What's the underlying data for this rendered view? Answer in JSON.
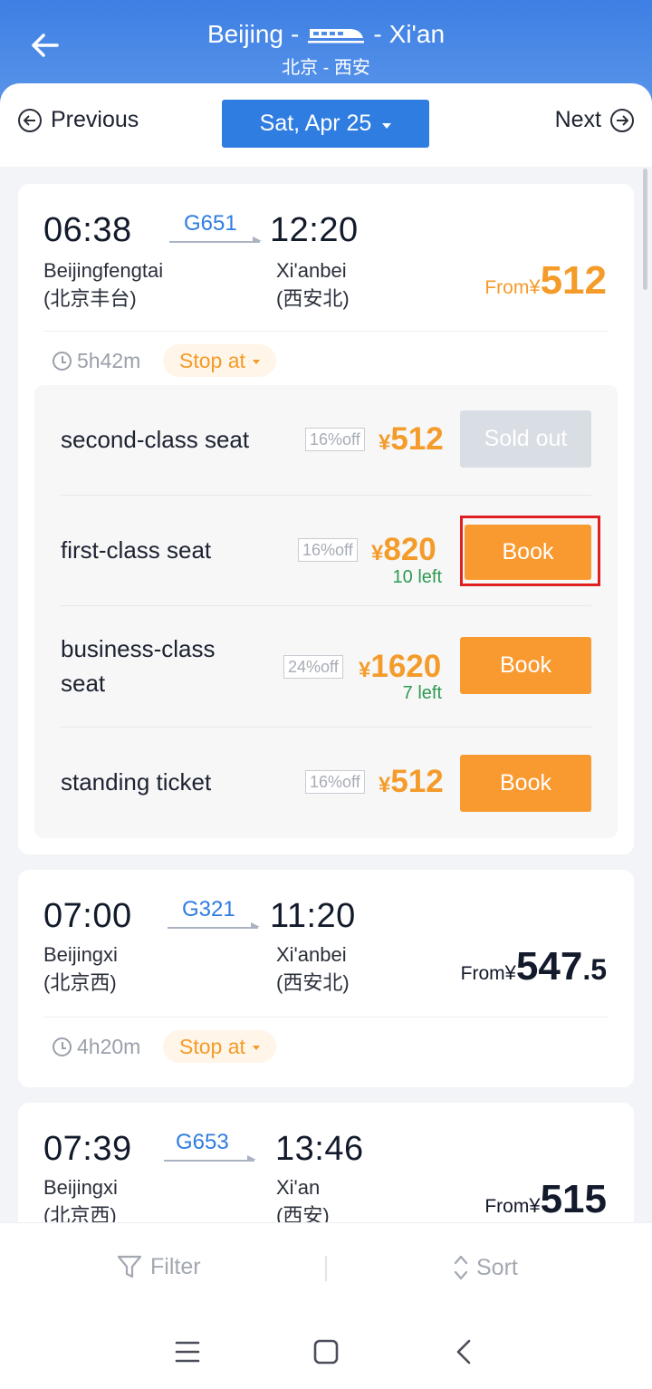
{
  "header": {
    "from_city": "Beijing",
    "to_city": "Xi'an",
    "route_cn": "北京 - 西安",
    "back_icon": "arrow-left-icon"
  },
  "datebar": {
    "prev_label": "Previous",
    "next_label": "Next",
    "date_label": "Sat, Apr 25"
  },
  "trains": [
    {
      "depart_time": "06:38",
      "train_no": "G651",
      "arrive_time": "12:20",
      "from_station": "Beijingfengtai",
      "from_station_cn": "(北京丰台)",
      "to_station": "Xi'anbei",
      "to_station_cn": "(西安北)",
      "from_label": "From",
      "currency": "¥",
      "price": "512",
      "duration": "5h42m",
      "stop_label": "Stop at",
      "seats": [
        {
          "name": "second-class seat",
          "discount": "16%off",
          "currency": "¥",
          "price": "512",
          "left": "",
          "button": "Sold out",
          "available": false
        },
        {
          "name": "first-class seat",
          "discount": "16%off",
          "currency": "¥",
          "price": "820",
          "left": "10 left",
          "button": "Book",
          "available": true
        },
        {
          "name_line1": "business-class",
          "name_line2": "seat",
          "discount": "24%off",
          "currency": "¥",
          "price": "1620",
          "left": "7 left",
          "button": "Book",
          "available": true
        },
        {
          "name": "standing ticket",
          "discount": "16%off",
          "currency": "¥",
          "price": "512",
          "left": "",
          "button": "Book",
          "available": true
        }
      ]
    },
    {
      "depart_time": "07:00",
      "train_no": "G321",
      "arrive_time": "11:20",
      "from_station": "Beijingxi",
      "from_station_cn": "(北京西)",
      "to_station": "Xi'anbei",
      "to_station_cn": "(西安北)",
      "from_label": "From",
      "currency": "¥",
      "price_int": "547",
      "price_dec": ".5",
      "duration": "4h20m",
      "stop_label": "Stop at"
    },
    {
      "depart_time": "07:39",
      "train_no": "G653",
      "arrive_time": "13:46",
      "from_station": "Beijingxi",
      "from_station_cn": "(北京西)",
      "to_station": "Xi'an",
      "to_station_cn": "(西安)",
      "from_label": "From",
      "currency": "¥",
      "price": "515"
    }
  ],
  "bottombar": {
    "filter_label": "Filter",
    "sort_label": "Sort"
  },
  "colors": {
    "brand_blue": "#2f7de1",
    "accent_orange": "#f99a31",
    "remaining_green": "#2e9a52",
    "highlight_red": "#e02020"
  }
}
